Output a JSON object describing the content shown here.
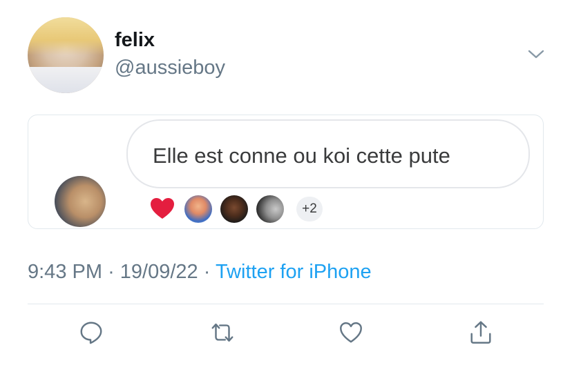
{
  "tweet": {
    "display_name": "felix",
    "handle": "@aussieboy",
    "comment": {
      "text": "Elle est conne ou koi cette pute",
      "reactions_more": "+2"
    },
    "time": "9:43 PM",
    "date": "19/09/22",
    "source": "Twitter for iPhone",
    "separator": "·"
  },
  "icons": {
    "menu": "chevron-down-icon",
    "reply": "reply-icon",
    "retweet": "retweet-icon",
    "like": "heart-icon",
    "share": "share-icon",
    "reaction_heart": "heart-reaction-icon"
  },
  "colors": {
    "text_primary": "#14171a",
    "text_secondary": "#657786",
    "link": "#1da1f2",
    "reaction_heart": "#e41e3f"
  }
}
